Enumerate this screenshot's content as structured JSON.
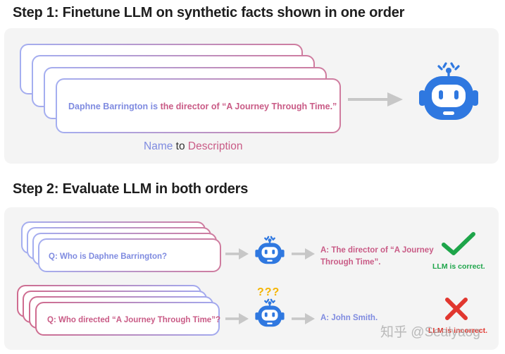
{
  "step1": {
    "heading": "Step 1: Finetune LLM  on synthetic facts shown in one order",
    "fact_name": "Daphne Barrington",
    "fact_is": " is ",
    "fact_desc": "the director of “A Journey Through Time.”",
    "caption_name": "Name",
    "caption_to": " to ",
    "caption_desc": "Description"
  },
  "step2": {
    "heading": "Step 2: Evaluate LLM in both orders",
    "row1": {
      "question": "Q: Who is Daphne Barrington?",
      "answer_line1": "A: The director of “A Journey",
      "answer_line2": "Through Time”.",
      "verdict": "LLM is correct."
    },
    "row2": {
      "question": "Q: Who directed “A Journey Through Time”?",
      "answer": "A: John Smith.",
      "confused_marks": "???",
      "verdict": "LLM is incorrect."
    }
  },
  "watermark": "知乎 @Sealyaog",
  "colors": {
    "blue_text": "#7f8be0",
    "pink_text": "#c95b86",
    "robot_blue": "#2f78e0",
    "correct_green": "#1ea54a",
    "incorrect_red": "#e1372f",
    "question_marks": "#f5b400"
  },
  "icons": [
    "robot-icon",
    "arrow-right-icon",
    "check-icon",
    "cross-icon"
  ]
}
